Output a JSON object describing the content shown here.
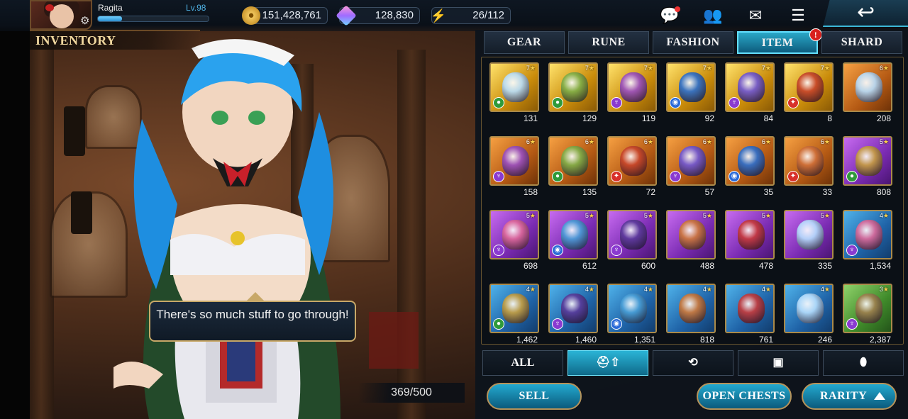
{
  "player": {
    "name": "Ragita",
    "level": "Lv.98",
    "exp_fraction": 0.22
  },
  "resources": {
    "gold": "151,428,761",
    "gems": "128,830",
    "energy": "26/112"
  },
  "screen_title": "INVENTORY",
  "dialogue": "There's so much stuff to go through!",
  "inventory_count": "369/500",
  "tabs": [
    {
      "label": "GEAR"
    },
    {
      "label": "RUNE"
    },
    {
      "label": "FASHION"
    },
    {
      "label": "ITEM",
      "alert": "!"
    },
    {
      "label": "SHARD"
    }
  ],
  "active_tab": "ITEM",
  "items": [
    {
      "stars": "7",
      "qty": "131",
      "rarity": "r7",
      "element": "green",
      "art": "#b8e0ff"
    },
    {
      "stars": "7",
      "qty": "129",
      "rarity": "r7",
      "element": "green",
      "art": "#7fb04a"
    },
    {
      "stars": "7",
      "qty": "119",
      "rarity": "r7",
      "element": "purple",
      "art": "#9a4fc4"
    },
    {
      "stars": "7",
      "qty": "92",
      "rarity": "r7",
      "element": "blue",
      "art": "#2b6fd0"
    },
    {
      "stars": "7",
      "qty": "84",
      "rarity": "r7",
      "element": "purple",
      "art": "#6f58d8"
    },
    {
      "stars": "7",
      "qty": "8",
      "rarity": "r7",
      "element": "red",
      "art": "#c8452b"
    },
    {
      "stars": "6",
      "qty": "208",
      "rarity": "r6",
      "element": "none",
      "art": "#b8e0ff"
    },
    {
      "stars": "6",
      "qty": "158",
      "rarity": "r6",
      "element": "purple",
      "art": "#9a4fc4"
    },
    {
      "stars": "6",
      "qty": "135",
      "rarity": "r6",
      "element": "green",
      "art": "#7fb04a"
    },
    {
      "stars": "6",
      "qty": "72",
      "rarity": "r6",
      "element": "red",
      "art": "#c8452b"
    },
    {
      "stars": "6",
      "qty": "57",
      "rarity": "r6",
      "element": "purple",
      "art": "#6f58d8"
    },
    {
      "stars": "6",
      "qty": "35",
      "rarity": "r6",
      "element": "blue",
      "art": "#2b6fd0"
    },
    {
      "stars": "6",
      "qty": "33",
      "rarity": "r6",
      "element": "red",
      "art": "#d0703a"
    },
    {
      "stars": "5",
      "qty": "808",
      "rarity": "r5",
      "element": "green",
      "art": "#c8a040"
    },
    {
      "stars": "5",
      "qty": "698",
      "rarity": "r5",
      "element": "purple",
      "art": "#e06a9a"
    },
    {
      "stars": "5",
      "qty": "612",
      "rarity": "r5",
      "element": "blue",
      "art": "#4aa0d8"
    },
    {
      "stars": "5",
      "qty": "600",
      "rarity": "r5",
      "element": "purple",
      "art": "#5a3a9a"
    },
    {
      "stars": "5",
      "qty": "488",
      "rarity": "r5",
      "element": "none",
      "art": "#d07a3a"
    },
    {
      "stars": "5",
      "qty": "478",
      "rarity": "r5",
      "element": "none",
      "art": "#c83a3a"
    },
    {
      "stars": "5",
      "qty": "335",
      "rarity": "r5",
      "element": "none",
      "art": "#b8e0ff"
    },
    {
      "stars": "4",
      "qty": "1,534",
      "rarity": "r4",
      "element": "purple",
      "art": "#e06a9a"
    },
    {
      "stars": "4",
      "qty": "1,462",
      "rarity": "r4",
      "element": "green",
      "art": "#c8a040"
    },
    {
      "stars": "4",
      "qty": "1,460",
      "rarity": "r4",
      "element": "purple",
      "art": "#5a3a9a"
    },
    {
      "stars": "4",
      "qty": "1,351",
      "rarity": "r4",
      "element": "blue",
      "art": "#4aa0d8"
    },
    {
      "stars": "4",
      "qty": "818",
      "rarity": "r4",
      "element": "none",
      "art": "#d07a3a"
    },
    {
      "stars": "4",
      "qty": "761",
      "rarity": "r4",
      "element": "none",
      "art": "#c83a3a"
    },
    {
      "stars": "4",
      "qty": "246",
      "rarity": "r4",
      "element": "none",
      "art": "#b8e0ff"
    },
    {
      "stars": "3",
      "qty": "2,387",
      "rarity": "r3",
      "element": "purple",
      "art": "#a08050"
    }
  ],
  "filters": [
    {
      "label": "ALL",
      "icon": ""
    },
    {
      "label": "",
      "icon": "helmet-upgrade-icon"
    },
    {
      "label": "",
      "icon": "potion-cycle-icon"
    },
    {
      "label": "",
      "icon": "chest-icon"
    },
    {
      "label": "",
      "icon": "pouch-icon"
    }
  ],
  "active_filter": 1,
  "buttons": {
    "sell": "SELL",
    "open_chests": "OPEN CHESTS",
    "rarity": "RARITY"
  },
  "colors": {
    "accent": "#2ab4d6",
    "gold_border": "#b6935a",
    "alert": "#d8201d"
  }
}
